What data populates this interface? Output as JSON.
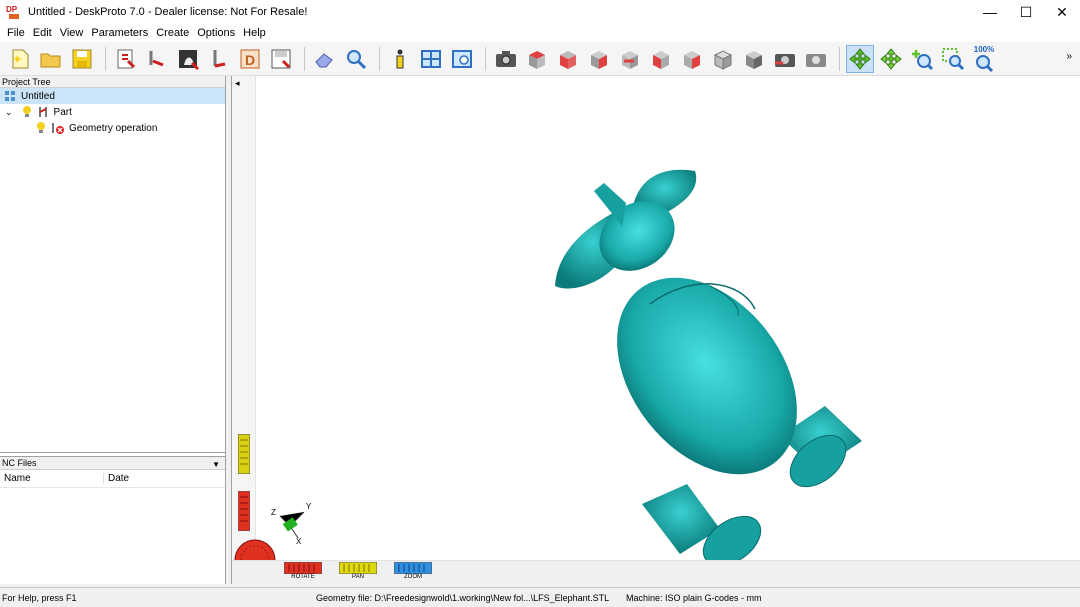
{
  "window": {
    "title": "Untitled - DeskProto 7.0 - Dealer license: Not For Resale!",
    "logo_text": "DP",
    "minimize_label": "—",
    "maximize_label": "☐",
    "close_label": "✕"
  },
  "menu": [
    "File",
    "Edit",
    "View",
    "Parameters",
    "Create",
    "Options",
    "Help"
  ],
  "toolbar": {
    "zoom_level": "100%",
    "more_label": "»",
    "icons": [
      "new-project-icon",
      "open-project-icon",
      "save-project-icon",
      "load-geometry-icon",
      "toolpath-icon",
      "bitmap-icon",
      "cutter-icon",
      "dp-icon",
      "save-geometry-icon",
      "eraser-icon",
      "magnifier-icon",
      "info-icon",
      "layout-icon",
      "view-icon",
      "camera-icon",
      "view-top-icon",
      "view-front-icon",
      "view-side-icon",
      "view-back-icon",
      "view-left-icon",
      "view-right-icon",
      "view-iso-icon",
      "view-solid-icon",
      "snapshot-icon",
      "render-icon",
      "rotate-mode-icon",
      "pan-mode-icon",
      "zoom-mode-icon",
      "zoom-window-icon",
      "zoom-100-icon"
    ]
  },
  "project_tree": {
    "header": "Project Tree",
    "root": "Untitled",
    "part": "Part",
    "operation": "Geometry operation"
  },
  "nc_files": {
    "header": "NC Files",
    "columns": [
      "Name",
      "Date"
    ]
  },
  "viewport": {
    "collapse_arrow": "◂",
    "controls": [
      "ROTATE",
      "PAN",
      "ZOOM"
    ],
    "axes": [
      "Z",
      "Y",
      "X"
    ],
    "model_color": "#20b7b7"
  },
  "status": {
    "help": "For Help, press F1",
    "geometry": "Geometry file: D:\\Freedesignwold\\1.working\\New fol...\\LFS_Elephant.STL",
    "machine": "Machine: ISO plain G-codes - mm"
  }
}
